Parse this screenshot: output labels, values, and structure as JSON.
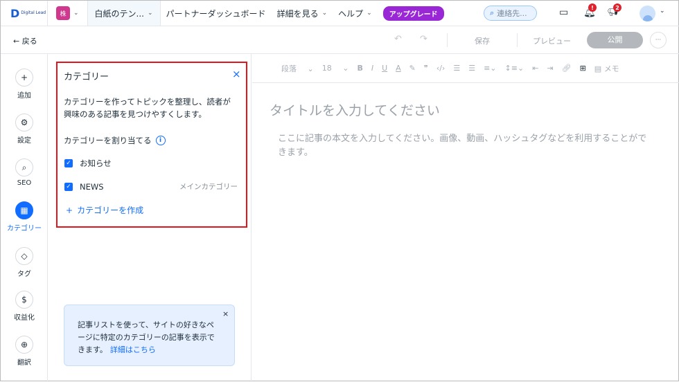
{
  "topbar": {
    "logo": "Digital Lead",
    "site_avatar": "株",
    "site_name": "白紙のテン...",
    "nav": [
      "パートナーダッシュボード",
      "詳細を見る",
      "ヘルプ"
    ],
    "upgrade": "アップグレード",
    "search_placeholder": "連絡先...",
    "notif_badge": "!",
    "announce_badge": "2"
  },
  "actionbar": {
    "back": "戻る",
    "save": "保存",
    "preview": "プレビュー",
    "publish": "公開",
    "more": "···"
  },
  "sidebar": {
    "items": [
      {
        "label": "追加",
        "icon": "+"
      },
      {
        "label": "設定",
        "icon": "⚙"
      },
      {
        "label": "SEO",
        "icon": "⌕"
      },
      {
        "label": "カテゴリー",
        "icon": "▦"
      },
      {
        "label": "タグ",
        "icon": "◇"
      },
      {
        "label": "収益化",
        "icon": "$"
      },
      {
        "label": "翻訳",
        "icon": "⊕"
      }
    ]
  },
  "panel": {
    "title": "カテゴリー",
    "close": "×",
    "description": "カテゴリーを作ってトピックを整理し、読者が興味のある記事を見つけやすくします。",
    "assign_label": "カテゴリーを割り当てる",
    "info": "i",
    "categories": [
      {
        "name": "お知らせ",
        "checked": true,
        "tag": ""
      },
      {
        "name": "NEWS",
        "checked": true,
        "tag": "メインカテゴリー"
      }
    ],
    "create": "カテゴリーを作成",
    "note": {
      "text": "記事リストを使って、サイトの好きなページに特定のカテゴリーの記事を表示できます。",
      "link": "詳細はこちら",
      "close": "×"
    }
  },
  "toolbar": {
    "paragraph": "段落",
    "font_size": "18",
    "bold": "B",
    "italic": "I",
    "underline": "U",
    "color": "A",
    "memo": "メモ"
  },
  "editor": {
    "title_placeholder": "タイトルを入力してください",
    "body_placeholder": "ここに記事の本文を入力してください。画像、動画、ハッシュタグなどを利用することができます。"
  }
}
